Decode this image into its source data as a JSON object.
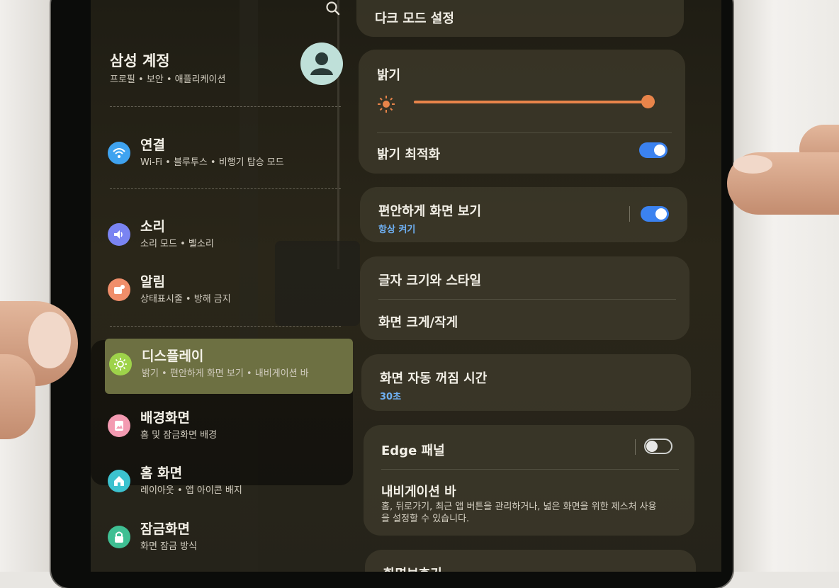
{
  "sidebar": {
    "account": {
      "title": "삼성 계정",
      "subtitle": "프로필 • 보안 • 애플리케이션"
    },
    "items": [
      {
        "title": "연결",
        "subtitle": "Wi-Fi • 블루투스 • 비행기 탑승 모드",
        "icon": "wifi-icon",
        "color": "#3fa3f0"
      },
      {
        "title": "소리",
        "subtitle": "소리 모드 • 벨소리",
        "icon": "volume-icon",
        "color": "#7a84f2"
      },
      {
        "title": "알림",
        "subtitle": "상태표시줄 • 방해 금지",
        "icon": "notification-icon",
        "color": "#f08e6a"
      },
      {
        "title": "디스플레이",
        "subtitle": "밝기 • 편안하게 화면 보기 • 내비게이션 바",
        "icon": "brightness-icon",
        "color": "#9ed34a"
      },
      {
        "title": "배경화면",
        "subtitle": "홈 및 잠금화면 배경",
        "icon": "wallpaper-icon",
        "color": "#f39ab1"
      },
      {
        "title": "홈 화면",
        "subtitle": "레이아웃 • 앱 아이콘 배지",
        "icon": "home-icon",
        "color": "#3cc2cf"
      },
      {
        "title": "잠금화면",
        "subtitle": "화면 잠금 방식",
        "icon": "lock-icon",
        "color": "#3fbf93"
      }
    ]
  },
  "display": {
    "dark_mode": "다크 모드 설정",
    "brightness": {
      "label": "밝기",
      "level": 1.0
    },
    "adaptive_brightness": {
      "label": "밝기 최적화",
      "on": true
    },
    "eye_comfort": {
      "label": "편안하게 화면 보기",
      "sub": "항상 켜기",
      "on": true
    },
    "font_size": "글자 크기와 스타일",
    "screen_zoom": "화면 크게/작게",
    "screen_timeout": {
      "label": "화면 자동 꺼짐 시간",
      "value": "30초"
    },
    "edge_panels": {
      "label": "Edge 패널",
      "on": false
    },
    "nav_bar": {
      "label": "내비게이션 바",
      "desc": "홈, 뒤로가기, 최근 앱 버튼을 관리하거나, 넓은 화면을 위한 제스처 사용을 설정할 수 있습니다."
    },
    "screen_saver": "화면보호기"
  },
  "colors": {
    "accent": "#3b82f0",
    "slider": "#e8844a",
    "selected": "#6d7042"
  }
}
